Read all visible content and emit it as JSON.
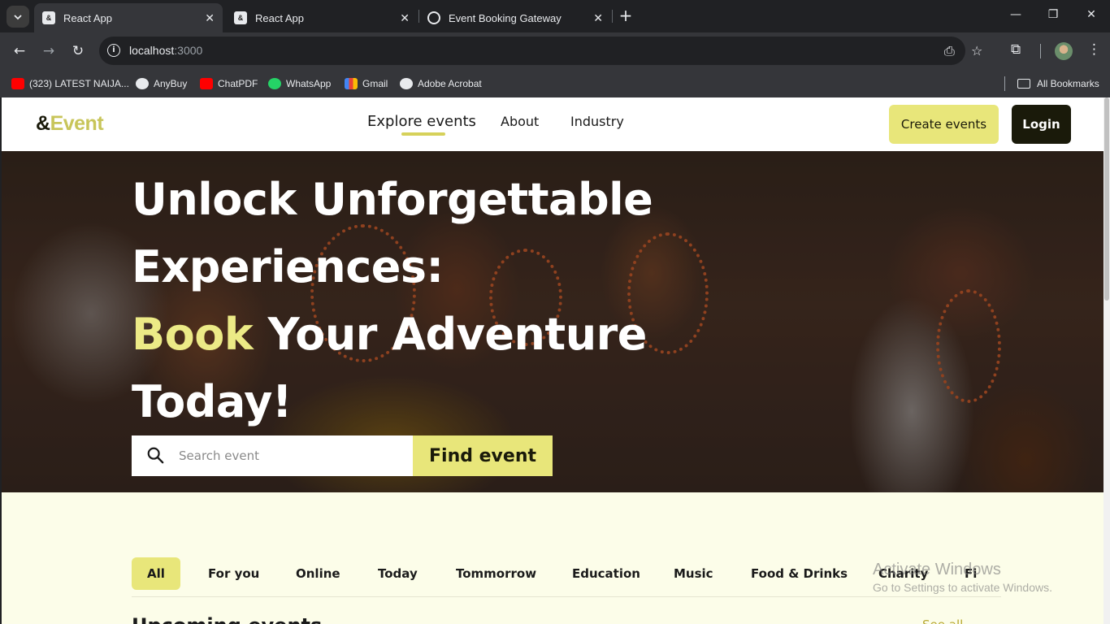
{
  "browser": {
    "tabs": [
      {
        "title": "React App",
        "active": true
      },
      {
        "title": "React App",
        "active": false
      },
      {
        "title": "Event Booking Gateway",
        "active": false
      }
    ],
    "new_tab": "+",
    "url_host": "localhost",
    "url_port": ":3000",
    "bookmarks": [
      {
        "label": "(323) LATEST NAIJA...",
        "icon": "youtube-icon"
      },
      {
        "label": "AnyBuy",
        "icon": "github-icon"
      },
      {
        "label": "ChatPDF",
        "icon": "youtube-icon"
      },
      {
        "label": "WhatsApp",
        "icon": "whatsapp-icon"
      },
      {
        "label": "Gmail",
        "icon": "gmail-icon"
      },
      {
        "label": "Adobe Acrobat",
        "icon": "acrobat-icon"
      }
    ],
    "all_bookmarks": "All Bookmarks"
  },
  "site": {
    "logo_prefix": "&",
    "logo_text": "Event",
    "nav": {
      "explore": "Explore events",
      "about": "About",
      "industry": "Industry"
    },
    "create_events": "Create events",
    "login": "Login"
  },
  "hero": {
    "line1": "Unlock Unforgettable",
    "line2": "Experiences:",
    "line3_highlight": "Book",
    "line3_rest": " Your Adventure",
    "line4": "Today!",
    "search_placeholder": "Search event",
    "find_button": "Find event"
  },
  "categories": [
    "All",
    "For you",
    "Online",
    "Today",
    "Tommorrow",
    "Education",
    "Music",
    "Food & Drinks",
    "Charity",
    "Fi"
  ],
  "active_category": "All",
  "section": {
    "title": "Upcoming events",
    "see_all": "See all"
  },
  "watermark": {
    "line1": "Activate Windows",
    "line2": "Go to Settings to activate Windows."
  },
  "colors": {
    "accent": "#e8e67a",
    "accent_text": "#ecea86",
    "dark": "#1a1a0a",
    "page_bg": "#fcfde9"
  }
}
